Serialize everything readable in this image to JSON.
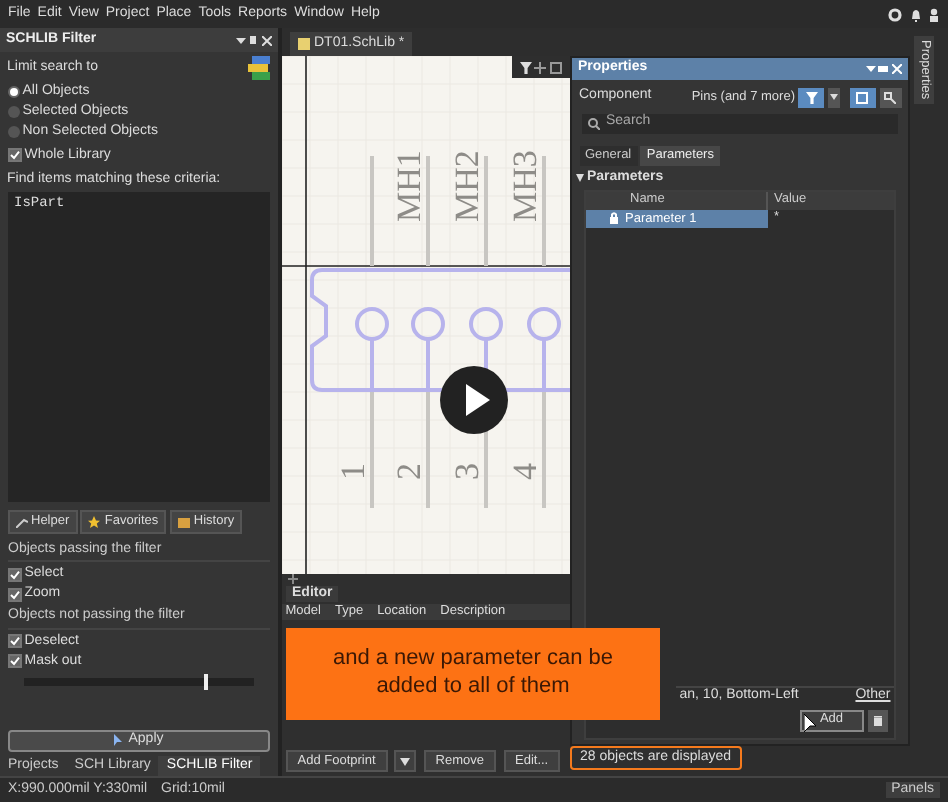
{
  "menu": [
    "File",
    "Edit",
    "View",
    "Project",
    "Place",
    "Tools",
    "Reports",
    "Window",
    "Help"
  ],
  "left_panel": {
    "title": "SCHLIB Filter",
    "limit_label": "Limit search to",
    "scope_options": [
      {
        "label": "All Objects",
        "selected": true
      },
      {
        "label": "Selected Objects",
        "selected": false
      },
      {
        "label": "Non Selected Objects",
        "selected": false
      }
    ],
    "whole_library": {
      "label": "Whole Library",
      "checked": true
    },
    "criteria_label": "Find items matching these criteria:",
    "criteria_value": "IsPart",
    "tool_buttons": [
      "Helper",
      "Favorites",
      "History"
    ],
    "passing_label": "Objects passing the filter",
    "passing_options": [
      {
        "label": "Select",
        "checked": true
      },
      {
        "label": "Zoom",
        "checked": true
      }
    ],
    "not_passing_label": "Objects not passing the filter",
    "not_passing_options": [
      {
        "label": "Deselect",
        "checked": true
      },
      {
        "label": "Mask out",
        "checked": true
      }
    ],
    "mask": {
      "level": 0.78
    },
    "apply": "Apply",
    "bottom_tabs": [
      {
        "label": "Projects",
        "selected": false
      },
      {
        "label": "SCH Library",
        "selected": false
      },
      {
        "label": "SCHLIB Filter",
        "selected": true
      }
    ]
  },
  "document_tab": "DT01.SchLib *",
  "canvas": {
    "designators": [
      "MH1",
      "MH2",
      "MH3"
    ],
    "pin_numbers": [
      "1",
      "2",
      "3",
      "4"
    ]
  },
  "editor": {
    "title": "Editor",
    "columns": [
      "Model",
      "Type",
      "Location",
      "Description"
    ],
    "buttons": [
      "Add Footprint",
      "Remove",
      "Edit..."
    ]
  },
  "properties": {
    "title": "Properties",
    "component_label": "Component",
    "selection": "Pins (and 7 more)",
    "search_placeholder": "Search",
    "tabs": [
      {
        "label": "General",
        "selected": false
      },
      {
        "label": "Parameters",
        "selected": true
      }
    ],
    "section": "Parameters",
    "columns": [
      "Name",
      "Value"
    ],
    "rows": [
      {
        "name": "Parameter 1",
        "value": "*",
        "selected": true
      }
    ],
    "font_text": "an, 10, Bottom-Left",
    "other": "Other",
    "add_button": "Add"
  },
  "selection_status": "28 objects are displayed",
  "callout": "and a new parameter can be added to all of them",
  "side_tab": "Properties",
  "status_bar": {
    "coords": "X:990.000mil Y:330mil",
    "grid": "Grid:10mil",
    "panels": "Panels"
  }
}
